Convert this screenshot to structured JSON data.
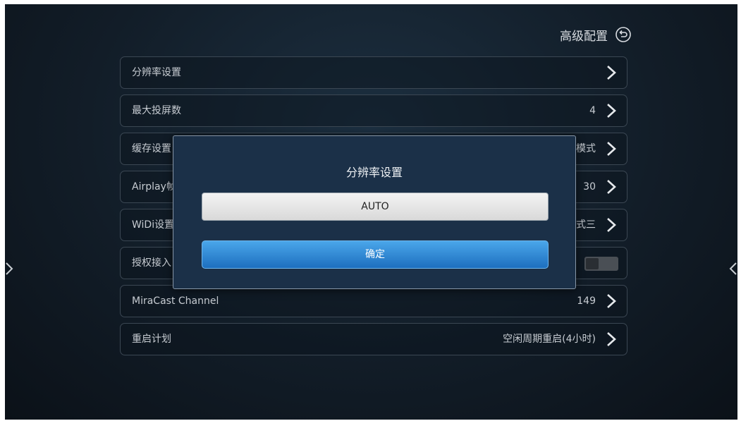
{
  "header": {
    "title": "高级配置"
  },
  "menu": {
    "items": [
      {
        "label": "分辨率设置",
        "value": ""
      },
      {
        "label": "最大投屏数",
        "value": "4"
      },
      {
        "label": "缓存设置",
        "value": "模式"
      },
      {
        "label": "Airplay帧",
        "value": "30"
      },
      {
        "label": "WiDi设置",
        "value": "式三"
      },
      {
        "label": "授权接入",
        "value": "",
        "toggle": "off"
      },
      {
        "label": "MiraCast Channel",
        "value": "149"
      },
      {
        "label": "重启计划",
        "value": "空闲周期重启(4小时)"
      }
    ]
  },
  "dialog": {
    "title": "分辨率设置",
    "option": "AUTO",
    "confirm": "确定"
  },
  "colors": {
    "background": "#121d28",
    "dialog": "#1b3048",
    "confirm_button": "#2b86d4"
  }
}
